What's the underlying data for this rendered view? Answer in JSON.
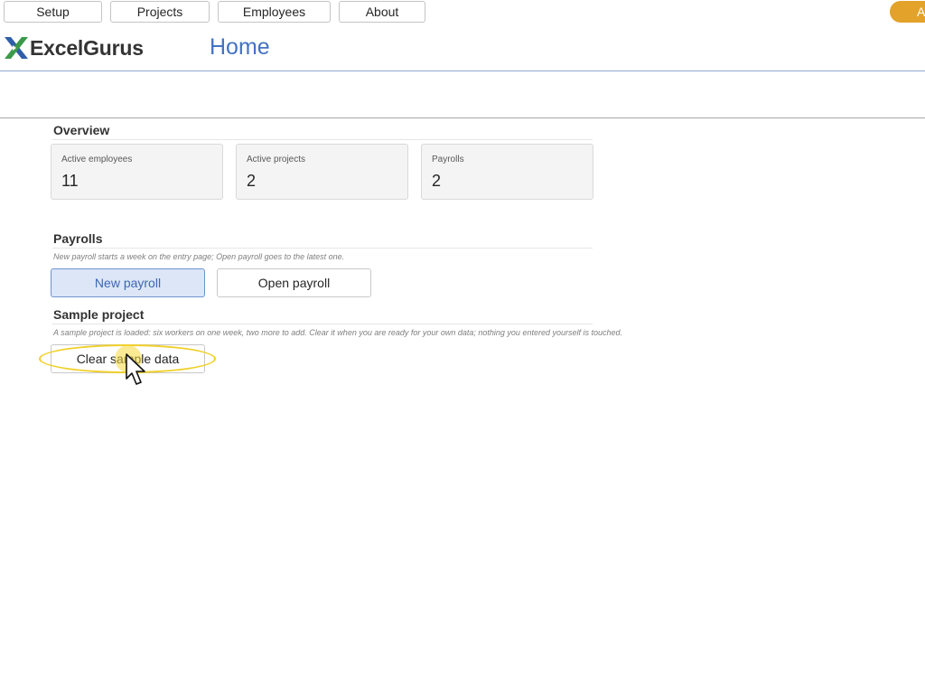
{
  "nav": {
    "setup": "Setup",
    "projects": "Projects",
    "employees": "Employees",
    "about": "About",
    "orange_pill_text": "A"
  },
  "brand": {
    "name": "ExcelGurus",
    "logo_colors": {
      "blue": "#2f5fa8",
      "green": "#3a9a4a"
    }
  },
  "page": {
    "title": "Home"
  },
  "overview": {
    "heading": "Overview",
    "cards": [
      {
        "label": "Active employees",
        "value": "11"
      },
      {
        "label": "Active projects",
        "value": "2"
      },
      {
        "label": "Payrolls",
        "value": "2"
      }
    ]
  },
  "payrolls": {
    "heading": "Payrolls",
    "hint": "New payroll starts a week on the entry page; Open payroll goes to the latest one.",
    "new_button": "New payroll",
    "open_button": "Open payroll"
  },
  "sample": {
    "heading": "Sample project",
    "hint": "A sample project is loaded: six workers on one week, two more to add. Clear it when you are ready for your own data; nothing you entered yourself is touched.",
    "clear_button": "Clear sample data"
  },
  "colors": {
    "accent": "#4472c4",
    "primary_button_bg": "#dce6f7",
    "orange_pill": "#e3a22a",
    "highlight": "#f0d02a"
  }
}
